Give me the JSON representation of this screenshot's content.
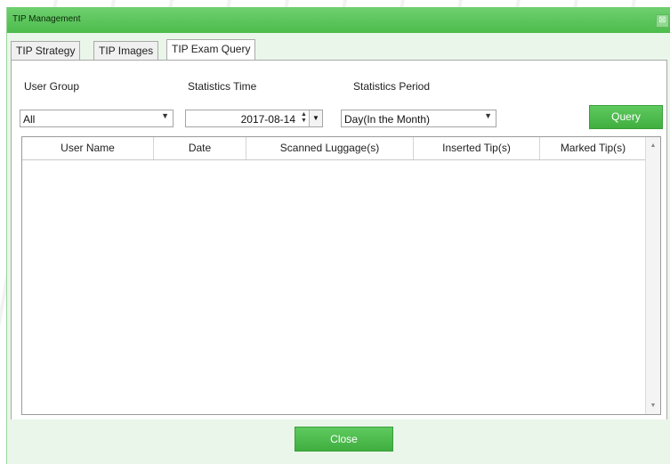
{
  "window": {
    "title": "TIP Management",
    "close_glyph": "⊠"
  },
  "tabs": [
    {
      "label": "TIP Strategy"
    },
    {
      "label": "TIP Images"
    },
    {
      "label": "TIP Exam Query"
    }
  ],
  "filters": {
    "user_group": {
      "label": "User Group",
      "value": "All"
    },
    "statistics_time": {
      "label": "Statistics Time",
      "value": "2017-08-14"
    },
    "statistics_period": {
      "label": "Statistics Period",
      "value": "Day(In the Month)"
    }
  },
  "buttons": {
    "query": "Query",
    "close": "Close"
  },
  "table": {
    "columns": [
      "User Name",
      "Date",
      "Scanned Luggage(s)",
      "Inserted Tip(s)",
      "Marked Tip(s)"
    ],
    "rows": []
  },
  "colors": {
    "accent": "#4cbc4c",
    "window_bg": "#eaf6ea"
  }
}
